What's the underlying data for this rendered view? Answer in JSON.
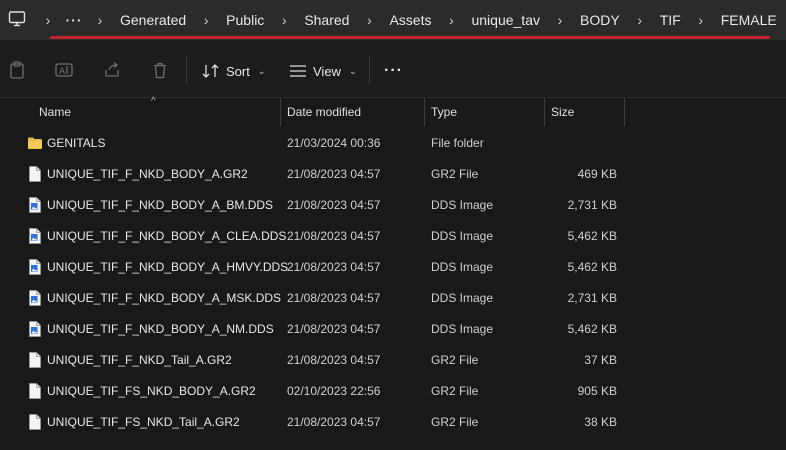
{
  "breadcrumb": {
    "items": [
      "Generated",
      "Public",
      "Shared",
      "Assets",
      "unique_tav",
      "BODY",
      "TIF",
      "FEMALE"
    ],
    "overflow_label": "···"
  },
  "toolbar": {
    "sort_label": "Sort",
    "view_label": "View",
    "more_label": "···"
  },
  "columns": {
    "name": "Name",
    "date": "Date modified",
    "type": "Type",
    "size": "Size"
  },
  "files": [
    {
      "name": "GENITALS",
      "date": "21/03/2024 00:36",
      "type": "File folder",
      "size": "",
      "icon": "folder-icon"
    },
    {
      "name": "UNIQUE_TIF_F_NKD_BODY_A.GR2",
      "date": "21/08/2023 04:57",
      "type": "GR2 File",
      "size": "469 KB",
      "icon": "file-icon"
    },
    {
      "name": "UNIQUE_TIF_F_NKD_BODY_A_BM.DDS",
      "date": "21/08/2023 04:57",
      "type": "DDS Image",
      "size": "2,731 KB",
      "icon": "image-file-icon"
    },
    {
      "name": "UNIQUE_TIF_F_NKD_BODY_A_CLEA.DDS",
      "date": "21/08/2023 04:57",
      "type": "DDS Image",
      "size": "5,462 KB",
      "icon": "image-file-icon"
    },
    {
      "name": "UNIQUE_TIF_F_NKD_BODY_A_HMVY.DDS",
      "date": "21/08/2023 04:57",
      "type": "DDS Image",
      "size": "5,462 KB",
      "icon": "image-file-icon"
    },
    {
      "name": "UNIQUE_TIF_F_NKD_BODY_A_MSK.DDS",
      "date": "21/08/2023 04:57",
      "type": "DDS Image",
      "size": "2,731 KB",
      "icon": "image-file-icon"
    },
    {
      "name": "UNIQUE_TIF_F_NKD_BODY_A_NM.DDS",
      "date": "21/08/2023 04:57",
      "type": "DDS Image",
      "size": "5,462 KB",
      "icon": "image-file-icon"
    },
    {
      "name": "UNIQUE_TIF_F_NKD_Tail_A.GR2",
      "date": "21/08/2023 04:57",
      "type": "GR2 File",
      "size": "37 KB",
      "icon": "file-icon"
    },
    {
      "name": "UNIQUE_TIF_FS_NKD_BODY_A.GR2",
      "date": "02/10/2023 22:56",
      "type": "GR2 File",
      "size": "905 KB",
      "icon": "file-icon"
    },
    {
      "name": "UNIQUE_TIF_FS_NKD_Tail_A.GR2",
      "date": "21/08/2023 04:57",
      "type": "GR2 File",
      "size": "38 KB",
      "icon": "file-icon"
    }
  ],
  "colors": {
    "background": "#191919",
    "addressbar": "#2b2b2b",
    "highlight_underline": "#c0232b",
    "folder": "#e8b84a",
    "image_badge": "#2f6fd6"
  }
}
